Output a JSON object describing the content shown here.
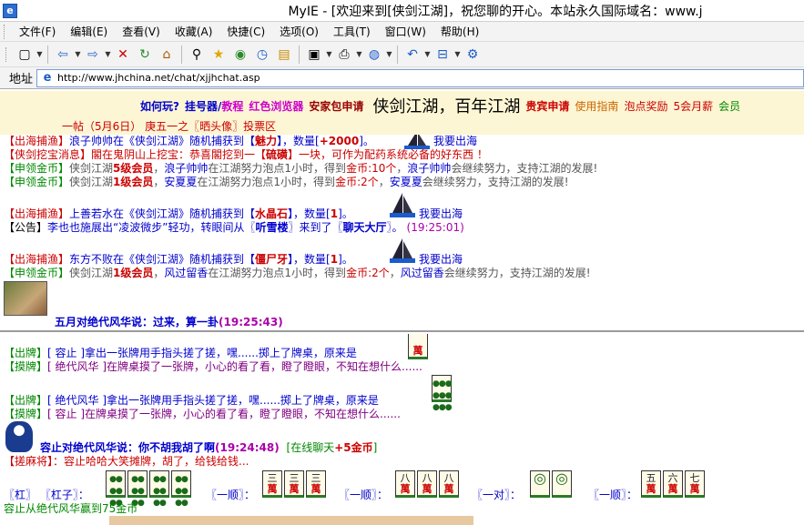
{
  "window": {
    "title": "MyIE - [欢迎来到[侠剑江湖]，祝您聊的开心。本站永久国际域名：www.j"
  },
  "menu": [
    "文件(F)",
    "编辑(E)",
    "查看(V)",
    "收藏(A)",
    "快捷(C)",
    "选项(O)",
    "工具(T)",
    "窗口(W)",
    "帮助(H)"
  ],
  "toolbar": {
    "icons": [
      "new-page-icon",
      "back-icon",
      "forward-icon",
      "stop-icon",
      "refresh-icon",
      "home-icon",
      "search-icon",
      "favorites-icon",
      "go-icon",
      "history-icon",
      "notes-icon",
      "window-icon",
      "print-icon",
      "globe-icon",
      "undo-icon",
      "tab-icon",
      "settings-icon"
    ]
  },
  "address": {
    "label": "地址",
    "url": "http://www.jhchina.net/chat/xjjhchat.asp"
  },
  "nav": {
    "items": [
      {
        "text": "如何玩?",
        "color": "#0000cc"
      },
      {
        "text": "挂号器/",
        "color": "#0000cc"
      },
      {
        "text": "教程",
        "color": "#cc00cc"
      },
      {
        "text": "红色浏览器",
        "color": "#cc00cc"
      },
      {
        "text": "安家包申请",
        "color": "#990000"
      }
    ],
    "big": "侠剑江湖，百年江湖",
    "items2": [
      {
        "text": "贵宾申请",
        "color": "#cc0000"
      },
      {
        "text": "使用指南",
        "color": "#cc6600"
      },
      {
        "text": "泡点奖励",
        "color": "#cc0000"
      },
      {
        "text": "5会月薪",
        "color": "#cc0000"
      },
      {
        "text": "会员",
        "color": "#008800"
      }
    ]
  },
  "notice": "一帖（5月6日）    庚五一之〖晒头像〗投票区",
  "pane1": {
    "l1": {
      "tag": "【出海捕渔】",
      "a": "浪子帅帅在《侠剑江湖》随机捕获到【",
      "item": "魅力",
      "b": "】，数量[",
      "n": "+2000",
      "c": "]。",
      "boat": "我要出海"
    },
    "l2": {
      "tag": "【侠剑挖宝消息】",
      "a": "閣在鬼阴山上挖宝：恭喜閣挖到一【",
      "item": "硫磺",
      "b": "】一块，可作为配药系统必备的好东西 ！"
    },
    "l3": {
      "tag": "【申领金币】",
      "a": "侠剑江湖",
      "lv": "5级会员",
      "sep": "，",
      "name": "浪子帅帅",
      "b": "在江湖努力泡点1小时，得到",
      "gold": "金币",
      "n": ":10个",
      "name2": "浪子帅帅",
      "c": "会继续努力，支持江湖的发展!"
    },
    "l4": {
      "tag": "【申领金币】",
      "a": "侠剑江湖",
      "lv": "1级会员",
      "sep": "，",
      "name": "安夏夏",
      "b": "在江湖努力泡点1小时，得到",
      "gold": "金币",
      "n": ":2个",
      "name2": "安夏夏",
      "c": "会继续努力，支持江湖的发展!"
    },
    "l5": {
      "tag": "【出海捕渔】",
      "a": "上善若水在《侠剑江湖》随机捕获到【",
      "item": "水晶石",
      "b": "】，数量[",
      "n": "1",
      "c": "]。",
      "boat": "我要出海"
    },
    "l6": {
      "tag": "【公告】",
      "a": "李也也施展出“凌波微步”轻功，转眼间从〖",
      "from": "听雪楼",
      "b": "〗来到了〖",
      "to": "聊天大厅",
      "c": "〗。",
      "time": "(19:25:01)"
    },
    "l7": {
      "tag": "【出海捕渔】",
      "a": "东方不败在《侠剑江湖》随机捕获到【",
      "item": "僵尸牙",
      "b": "】，数量[",
      "n": "1",
      "c": "]。",
      "boat": "我要出海"
    },
    "l8": {
      "tag": "【申领金币】",
      "a": "侠剑江湖",
      "lv": "1级会员",
      "sep": "，",
      "name": "风过留香",
      "b": "在江湖努力泡点1小时，得到",
      "gold": "金币",
      "n": ":2个",
      "name2": "风过留香",
      "c": "会继续努力，支持江湖的发展!"
    },
    "l9": {
      "who": "五月对",
      "to": "绝代风华",
      "says": "说：过来，算一卦",
      "time": "(19:25:43)"
    }
  },
  "pane2": {
    "l1": {
      "tag": "【出牌】",
      "a": "[ 容止 ]拿出一张牌用手指头搓了搓，嘿......掷上了牌桌，原来是",
      "tile": "萬"
    },
    "l2": {
      "tag": "【摸牌】",
      "a": "[ 绝代风华 ]在牌桌摸了一张牌，小心的看了看，瞪了瞪眼，不知在想什么......"
    },
    "l3": {
      "tag": "【出牌】",
      "a": "[ 绝代风华 ]拿出一张牌用手指头搓了搓，嘿......掷上了牌桌，原来是"
    },
    "l4": {
      "tag": "【摸牌】",
      "a": "[ 容止 ]在牌桌摸了一张牌，小心的看了看，瞪了瞪眼，不知在想什么......"
    },
    "l5": {
      "who": "容止对",
      "to": "绝代风华",
      "says": "说：你不胡我胡了啊",
      "time": "(19:24:48)",
      "extra": "[在线聊天",
      "gold": "+5金币",
      "end": "]"
    },
    "l6": {
      "tag": "【搓麻将】",
      "a": "：容止哈哈大笑摊牌，胡了，给钱给钱..."
    },
    "l7": {
      "gang": "〖杠〗",
      "gangz": "〖杠子〗：",
      "yishun1": "〖一顺〗：",
      "yishun2": "〖一顺〗：",
      "yidui": "〖一对〗：",
      "yishun3": "〖一顺〗：",
      "nums1": [
        "三",
        "三",
        "三"
      ],
      "nums2": [
        "八",
        "八",
        "八"
      ],
      "nums3": [
        "五",
        "六",
        "七"
      ],
      "wan": "萬"
    },
    "l8": "容止从绝代风华赢到75金币"
  }
}
